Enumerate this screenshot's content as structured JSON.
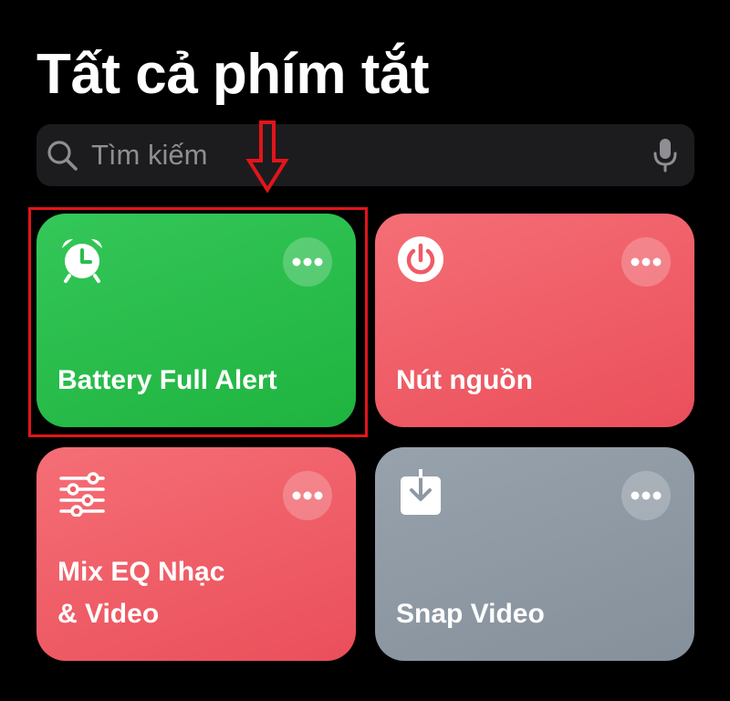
{
  "header": {
    "title": "Tất cả phím tắt"
  },
  "search": {
    "placeholder": "Tìm kiếm",
    "value": ""
  },
  "shortcuts": [
    {
      "label": "Battery Full Alert",
      "icon": "alarm-clock-icon",
      "color": "#2bbd4b"
    },
    {
      "label": "Nút nguồn",
      "icon": "power-icon",
      "color": "#ee5b65"
    },
    {
      "label": "Mix EQ Nhạc\n& Video",
      "icon": "sliders-icon",
      "color": "#ee5b65"
    },
    {
      "label": "Snap Video",
      "icon": "download-icon",
      "color": "#8e98a3"
    }
  ],
  "annotation": {
    "highlight_color": "#e3141b"
  }
}
